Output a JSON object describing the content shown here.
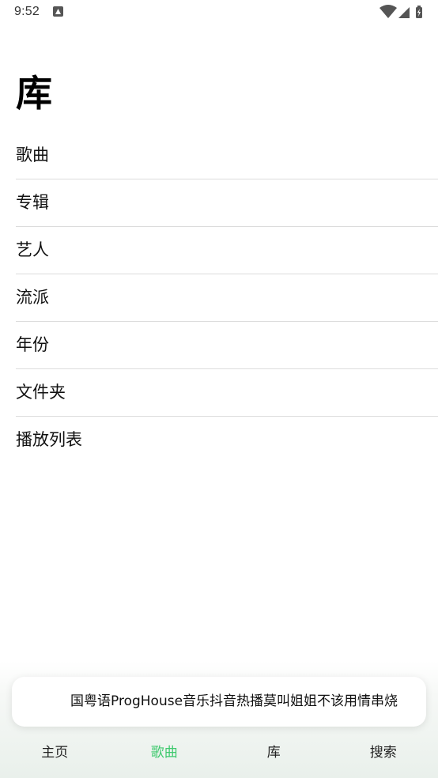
{
  "status_bar": {
    "time": "9:52",
    "notification_icon": "notification-a-icon",
    "icons": [
      "wifi-icon",
      "cell-signal-icon",
      "battery-icon"
    ]
  },
  "library": {
    "title": "库",
    "items": [
      {
        "label": "歌曲"
      },
      {
        "label": "专辑"
      },
      {
        "label": "艺人"
      },
      {
        "label": "流派"
      },
      {
        "label": "年份"
      },
      {
        "label": "文件夹"
      },
      {
        "label": "播放列表"
      }
    ]
  },
  "now_playing": {
    "title": "国粤语ProgHouse音乐抖音热播莫叫姐姐不该用情串烧"
  },
  "bottom_nav": {
    "tabs": [
      {
        "label": "主页"
      },
      {
        "label": "歌曲"
      },
      {
        "label": "库"
      },
      {
        "label": "搜索"
      }
    ],
    "active_index": 1
  },
  "colors": {
    "accent": "#3ec96e",
    "divider": "#dcdcdc"
  }
}
